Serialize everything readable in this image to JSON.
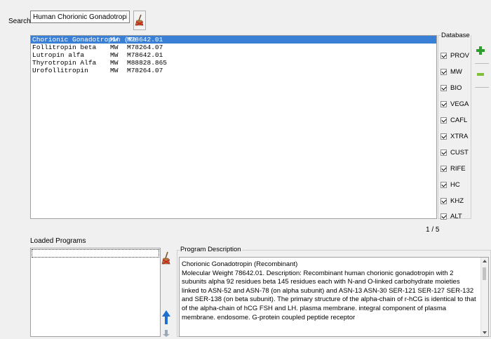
{
  "search": {
    "label": "Search",
    "value": "Human Chorionic Gonadotropin"
  },
  "results": {
    "rows": [
      {
        "name": "Chorionic Gonadotropin (Re",
        "unit": "MW",
        "value": "M78642.01",
        "selected": true
      },
      {
        "name": "Follitropin beta",
        "unit": "MW",
        "value": "M78264.07",
        "selected": false
      },
      {
        "name": "Lutropin alfa",
        "unit": "MW",
        "value": "M78642.01",
        "selected": false
      },
      {
        "name": "Thyrotropin Alfa",
        "unit": "MW",
        "value": "M88828.865",
        "selected": false
      },
      {
        "name": "Urofollitropin",
        "unit": "MW",
        "value": "M78264.07",
        "selected": false
      }
    ],
    "page": "1 / 5"
  },
  "database": {
    "title": "Database",
    "items": [
      "PROV",
      "MW",
      "BIO",
      "VEGA",
      "CAFL",
      "XTRA",
      "CUST",
      "RIFE",
      "HC",
      "KHZ",
      "ALT"
    ],
    "checked": [
      true,
      true,
      true,
      true,
      true,
      true,
      true,
      true,
      true,
      true,
      true
    ]
  },
  "loaded": {
    "label": "Loaded Programs"
  },
  "description": {
    "title": "Program Description",
    "text": "Chorionic Gonadotropin (Recombinant)\nMolecular Weight 78642.01. Description: Recombinant human chorionic gonadotropin with 2 subunits alpha 92 residues beta 145 residues each with N-and O-linked carbohydrate moieties linked to ASN-52 and ASN-78 (on alpha subunit) and ASN-13 ASN-30 SER-121 SER-127 SER-132 and SER-138 (on beta subunit). The primary structure of the alpha-chain of r-hCG is identical to that of the alpha-chain of hCG FSH and LH. plasma membrane. integral component of plasma membrane. endosome. G-protein coupled peptide receptor"
  },
  "icons": {
    "clear": "broom-clear-icon",
    "add": "plus-icon",
    "remove": "minus-icon",
    "up": "arrow-up-icon",
    "down": "arrow-down-icon"
  },
  "colors": {
    "selection": "#3a7fd6",
    "add": "#2e9e2e",
    "up": "#1e6fd0"
  }
}
